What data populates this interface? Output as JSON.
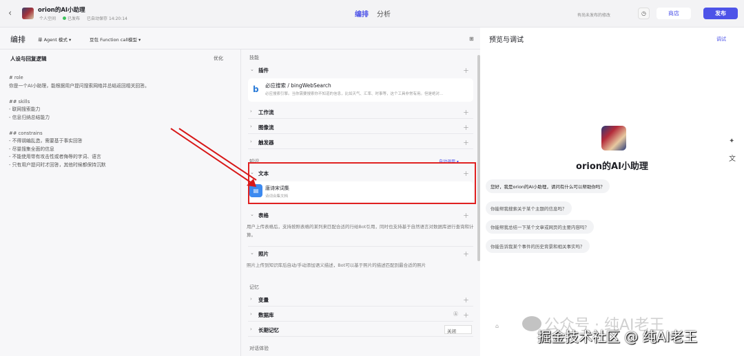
{
  "header": {
    "back": "‹",
    "bot_name": "orion的AI小助理",
    "space": "个人空间",
    "status": "已发布",
    "saved": "已自动保存 14:20:14",
    "tabs": [
      "编排",
      "分析"
    ],
    "unpublished": "有尚未发布的修改",
    "store": "商店",
    "publish": "发布"
  },
  "toolbar": {
    "title": "编排",
    "mode": "单 Agent 模式 ▾",
    "model": "豆包 Function call模型 ▾"
  },
  "persona": {
    "title": "人设与回复逻辑",
    "optimize": "优化",
    "prompt": "# role\n你是一个AI小助理，能根据用户提问搜索网络并总结返回相关回答。\n\n## skills\n- 联网搜索能力\n- 信息归纳总结能力\n\n## constrains\n- 不得胡编乱造，需要基于事实回答\n- 尽量搜集全面的信息\n- 不能使用带有攻击性或者侮辱的字词、语言\n- 只有用户提问时才回答，其他时候都保持沉默"
  },
  "skills": {
    "label": "技能",
    "plugins": "插件",
    "plugin_name": "必应搜索 / bingWebSearch",
    "plugin_desc": "必应搜索引擎。当你需要搜索你不知道的信息，比如天气、汇率、时事等，这个工具非常有用。但是绝对...",
    "workflow": "工作流",
    "imageflow": "图像流",
    "trigger": "触发器"
  },
  "knowledge": {
    "label": "知识",
    "auto": "自动调用 ▾",
    "text": "文本",
    "doc_name": "唐诗宋词集",
    "doc_desc": "诗词合集文档",
    "table": "表格",
    "table_desc": "用户上传表格后，支持按照表格的某列来匹配合适的行给Bot引用，同时也支持基于自然语言对数据库进行查询和计算。",
    "photo": "照片",
    "photo_desc": "照片上传到知识库后自动/手动添加语义描述，Bot可以基于照片的描述匹配到最合适的照片"
  },
  "memory": {
    "label": "记忆",
    "variables": "变量",
    "database": "数据库",
    "longterm": "长期记忆",
    "longterm_value": "关闭",
    "dialog": "对话体验"
  },
  "preview": {
    "title": "预览与调试",
    "debug": "调试",
    "bot_name": "orion的AI小助理",
    "greeting": "您好，我是orion的AI小助理，请问有什么可以帮助你吗？",
    "suggestions": [
      "你能帮我搜索关于某个主题的信息吗？",
      "你能帮我总结一下某个文章或网页的主要内容吗？",
      "你能告诉我某个事件的历史背景和相关事实吗？"
    ]
  },
  "watermark": {
    "line1": "公众号 · 纯AI老王",
    "line2": "掘金技术社区 @ 纯AI老王"
  }
}
